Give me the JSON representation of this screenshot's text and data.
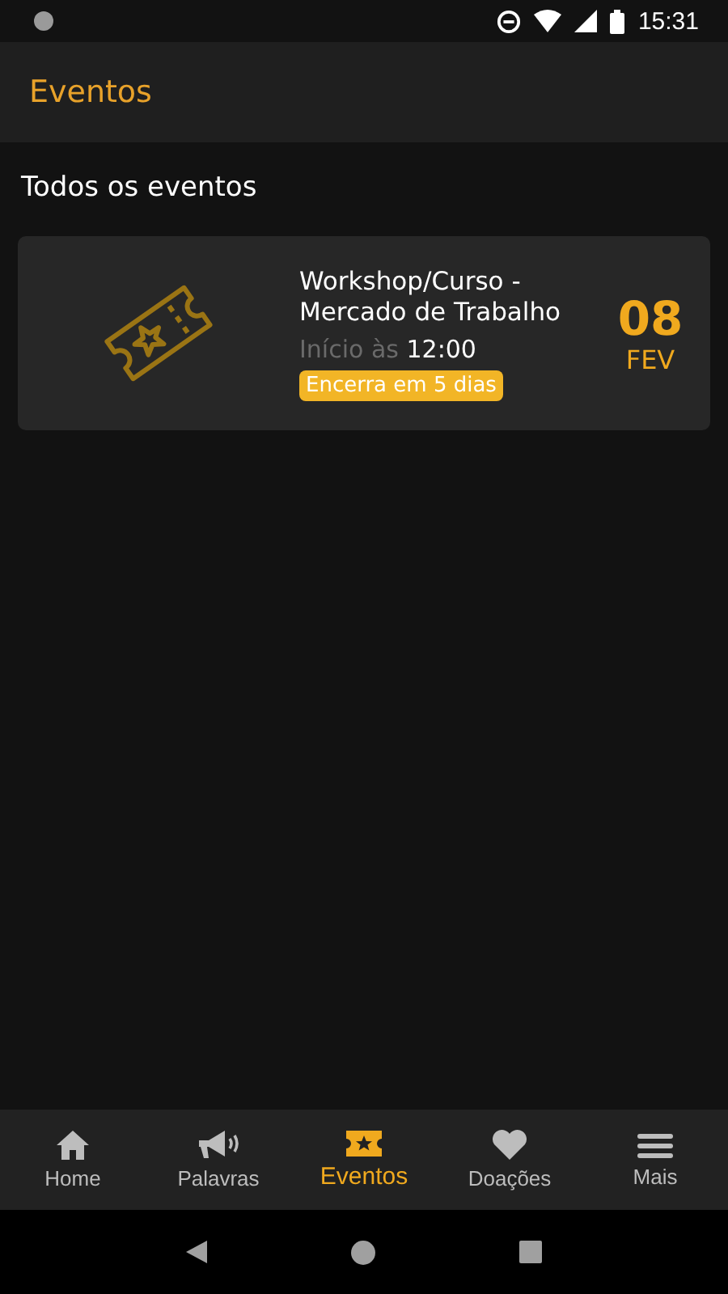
{
  "status_bar": {
    "time": "15:31"
  },
  "app_bar": {
    "title": "Eventos"
  },
  "section_title": "Todos os eventos",
  "events": [
    {
      "title": "Workshop/Curso - Mercado de Trabalho",
      "start_label": "Início às",
      "start_time": "12:00",
      "badge": "Encerra em 5 dias",
      "day": "08",
      "month": "FEV"
    }
  ],
  "tabs": [
    {
      "kind": "home",
      "label": "Home",
      "selected": false
    },
    {
      "kind": "megaphone",
      "label": "Palavras",
      "selected": false
    },
    {
      "kind": "ticket",
      "label": "Eventos",
      "selected": true
    },
    {
      "kind": "heart",
      "label": "Doações",
      "selected": false
    },
    {
      "kind": "menu",
      "label": "Mais",
      "selected": false
    }
  ]
}
